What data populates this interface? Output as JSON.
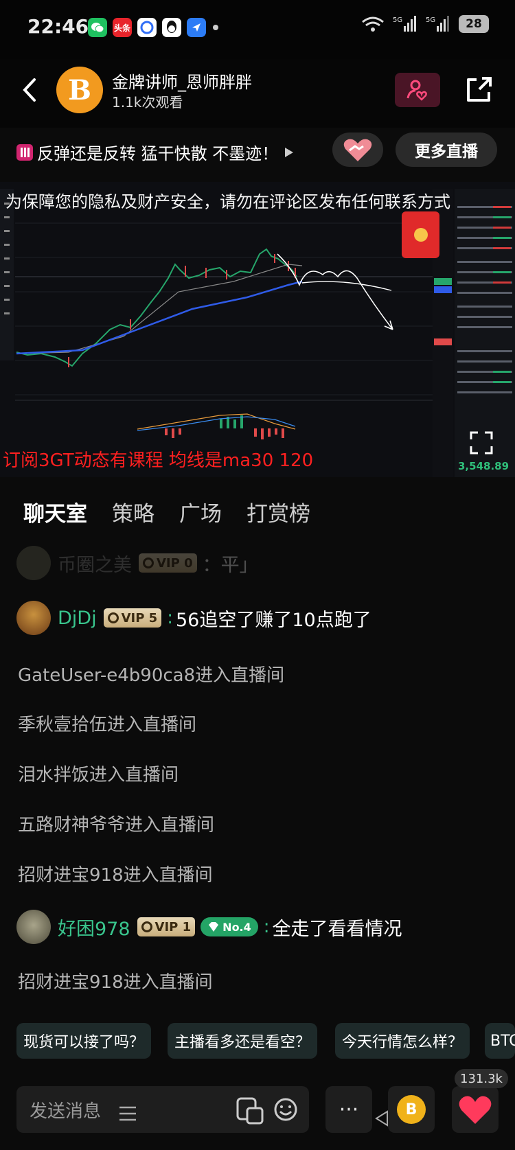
{
  "status_bar": {
    "time": "22:46",
    "battery": "28",
    "app_label_toutiao": "头条"
  },
  "header": {
    "streamer_name": "金牌讲师_恩师胖胖",
    "view_count": "1.1k次观看",
    "avatar_glyph": "B"
  },
  "topic": {
    "title": "反弹还是反转 猛干快散 不墨迹！",
    "more_live_label": "更多直播"
  },
  "video": {
    "notice": "为保障您的隐私及财产安全，请勿在评论区发布任何联系方式",
    "overlay_text": "订阅3GT动态有课程 均线是ma30 120",
    "price_readout": "3,548.89"
  },
  "tabs": [
    {
      "label": "聊天室"
    },
    {
      "label": "策略"
    },
    {
      "label": "广场"
    },
    {
      "label": "打赏榜"
    }
  ],
  "chat": {
    "faded": {
      "name": "币圈之美",
      "vip": "VIP 0",
      "text": "：平」"
    },
    "messages": [
      {
        "name": "DjDj",
        "vip": "VIP 5",
        "text": "56追空了赚了10点跑了"
      },
      {
        "system": "GateUser-e4b90ca8进入直播间"
      },
      {
        "system": "季秋壹拾伍进入直播间"
      },
      {
        "system": "泪水拌饭进入直播间"
      },
      {
        "system": "五路财神爷爷进入直播间"
      },
      {
        "system": "招财进宝918进入直播间"
      },
      {
        "name": "好困978",
        "vip": "VIP 1",
        "badge": "No.4",
        "text": "全走了看看情况"
      },
      {
        "system": "招财进宝918进入直播间"
      }
    ]
  },
  "quick_replies": [
    "现货可以接了吗？",
    "主播看多还是看空？",
    "今天行情怎么样？",
    "BTC"
  ],
  "bottom_bar": {
    "input_placeholder": "发送消息",
    "more_label": "···",
    "like_count": "131.3k",
    "coin_glyph": "B"
  },
  "colors": {
    "accent_green": "#39c58d",
    "topic_pink": "#d1256f",
    "like_red": "#ff3a5c",
    "coin": "#f0b21a"
  }
}
